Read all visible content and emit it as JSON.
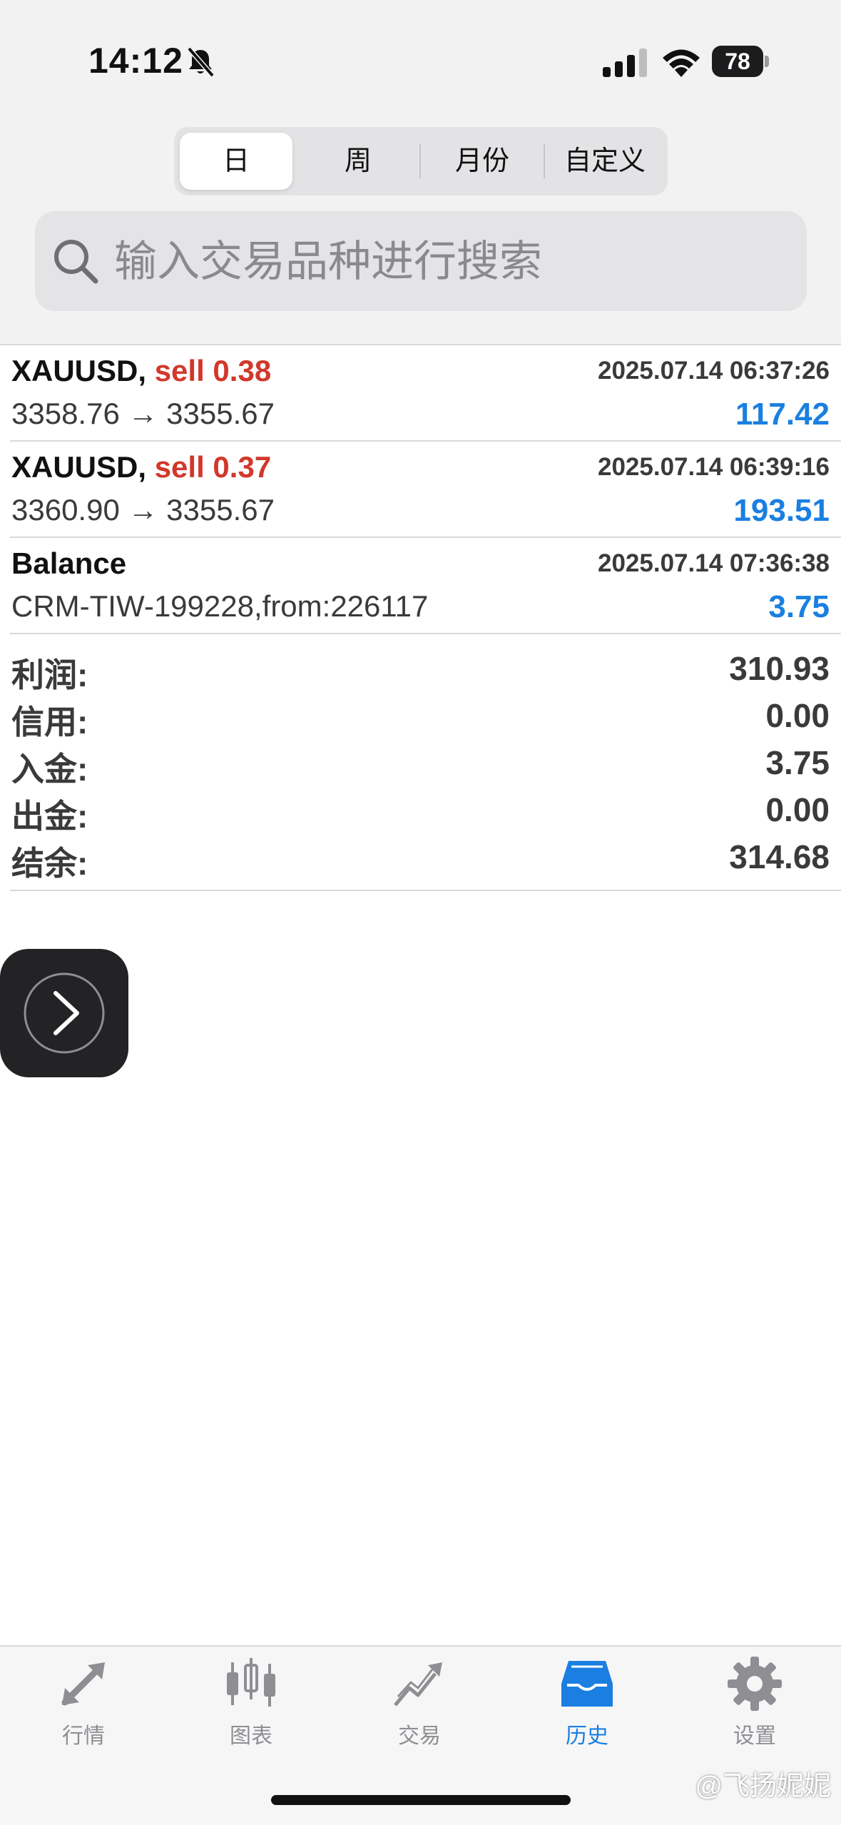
{
  "status_bar": {
    "time": "14:12",
    "battery": "78"
  },
  "segments": [
    {
      "label": "日",
      "active": true
    },
    {
      "label": "周"
    },
    {
      "label": "月份"
    },
    {
      "label": "自定义"
    }
  ],
  "search": {
    "placeholder": "输入交易品种进行搜索"
  },
  "deals": [
    {
      "symbol": "XAUUSD,",
      "action": "sell 0.38",
      "time": "2025.07.14 06:37:26",
      "prices": "3358.76 → 3355.67",
      "profit": "117.42"
    },
    {
      "symbol": "XAUUSD,",
      "action": "sell 0.37",
      "time": "2025.07.14 06:39:16",
      "prices": "3360.90 → 3355.67",
      "profit": "193.51"
    },
    {
      "symbol": "Balance",
      "action": "",
      "time": "2025.07.14 07:36:38",
      "prices": "CRM-TIW-199228,from:226117",
      "profit": "3.75"
    }
  ],
  "summary": [
    {
      "label": "利润:",
      "value": "310.93"
    },
    {
      "label": "信用:",
      "value": "0.00"
    },
    {
      "label": "入金:",
      "value": "3.75"
    },
    {
      "label": "出金:",
      "value": "0.00"
    },
    {
      "label": "结余:",
      "value": "314.68"
    }
  ],
  "tabs": [
    {
      "label": "行情",
      "icon": "quotes-icon"
    },
    {
      "label": "图表",
      "icon": "chart-icon"
    },
    {
      "label": "交易",
      "icon": "trade-icon"
    },
    {
      "label": "历史",
      "icon": "history-icon",
      "active": true
    },
    {
      "label": "设置",
      "icon": "gear-icon"
    }
  ],
  "watermark": "@飞扬妮妮",
  "colors": {
    "accent": "#1a7fe0",
    "sell": "#d2382b",
    "text_secondary": "#3a3a3c"
  }
}
